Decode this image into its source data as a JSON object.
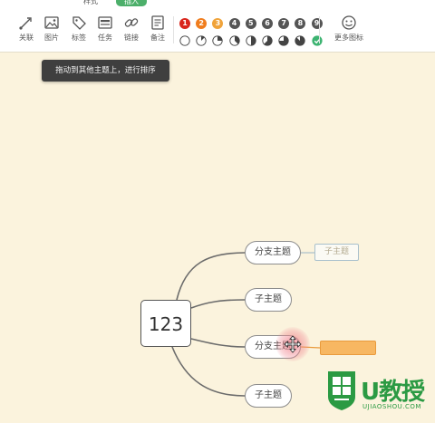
{
  "tabs": {
    "style": "样式",
    "insert": "插入"
  },
  "toolbar": {
    "tools": [
      {
        "label": "关联",
        "icon": "relation-icon"
      },
      {
        "label": "图片",
        "icon": "image-icon"
      },
      {
        "label": "标签",
        "icon": "tag-icon"
      },
      {
        "label": "任务",
        "icon": "task-icon"
      },
      {
        "label": "链接",
        "icon": "link-icon"
      },
      {
        "label": "备注",
        "icon": "note-icon"
      }
    ],
    "more_label": "更多图标",
    "priorities": [
      "1",
      "2",
      "3",
      "4",
      "5",
      "6",
      "7",
      "8",
      "9"
    ],
    "priority_colors": [
      "#d9251c",
      "#f07d1e",
      "#f0a33a",
      "#555555",
      "#555555",
      "#555555",
      "#555555",
      "#555555",
      "#555555"
    ],
    "progress_levels": [
      0,
      0.125,
      0.25,
      0.375,
      0.5,
      0.625,
      0.75,
      0.875,
      1.0
    ]
  },
  "tooltip": {
    "text": "拖动到其他主题上，进行排序"
  },
  "mindmap": {
    "central": "123",
    "branches": [
      "分支主题",
      "子主题",
      "分支主题",
      "子主题"
    ],
    "ghost_child": "子主题"
  },
  "watermark": {
    "brand": "U教授",
    "url": "UJIAOSHOU.COM"
  },
  "colors": {
    "canvas_bg": "#fbf3dd",
    "accent": "#4caf6a",
    "drop_target": "#f7b762"
  }
}
